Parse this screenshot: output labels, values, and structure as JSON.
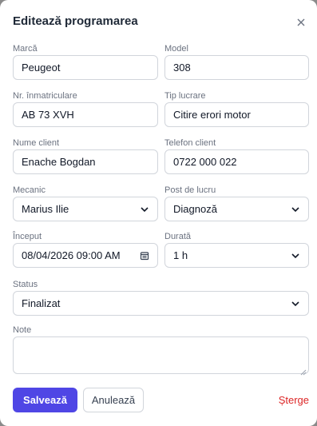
{
  "dialog": {
    "title": "Editează programarea",
    "close_icon": "close-icon"
  },
  "fields": {
    "brand": {
      "label": "Marcă",
      "value": "Peugeot"
    },
    "model": {
      "label": "Model",
      "value": "308"
    },
    "plate": {
      "label": "Nr. înmatriculare",
      "value": "AB 73 XVH"
    },
    "job_type": {
      "label": "Tip lucrare",
      "value": "Citire erori motor"
    },
    "client_name": {
      "label": "Nume client",
      "value": "Enache Bogdan"
    },
    "client_phone": {
      "label": "Telefon client",
      "value": "0722 000 022"
    },
    "mechanic": {
      "label": "Mecanic",
      "value": "Marius Ilie"
    },
    "workstation": {
      "label": "Post de lucru",
      "value": "Diagnoză"
    },
    "start": {
      "label": "Început",
      "value": "08/04/2026 09:00 AM",
      "icon": "calendar-icon"
    },
    "duration": {
      "label": "Durată",
      "value": "1 h"
    },
    "status": {
      "label": "Status",
      "value": "Finalizat"
    },
    "notes": {
      "label": "Note",
      "value": ""
    }
  },
  "actions": {
    "save": "Salvează",
    "cancel": "Anulează",
    "delete": "Șterge"
  },
  "colors": {
    "primary": "#4f46e5",
    "danger": "#dc2626"
  }
}
